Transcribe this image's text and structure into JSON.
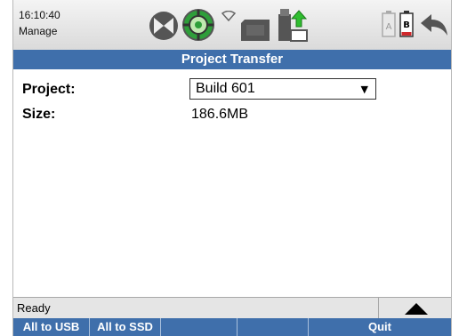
{
  "header": {
    "time": "16:10:40",
    "mode": "Manage",
    "icons": [
      "wheel-icon",
      "gps-target-icon",
      "wifi-icon",
      "sd-card-icon",
      "usb-upload-icon",
      "battery-a-icon",
      "battery-b-icon",
      "back-arrow-icon"
    ],
    "battery_a_label": "A",
    "battery_b_label": "B"
  },
  "title": "Project Transfer",
  "form": {
    "project_label": "Project:",
    "project_value": "Build 601",
    "size_label": "Size:",
    "size_value": "186.6MB"
  },
  "status": {
    "text": "Ready"
  },
  "softkeys": [
    {
      "label": "All to USB"
    },
    {
      "label": "All to SSD"
    },
    {
      "label": ""
    },
    {
      "label": ""
    },
    {
      "label": "Quit"
    }
  ],
  "colors": {
    "bar_blue": "#3f6fab",
    "gps_green": "#2e9e3a",
    "usb_arrow_green": "#2fbe2f",
    "battery_red": "#d0282c"
  }
}
